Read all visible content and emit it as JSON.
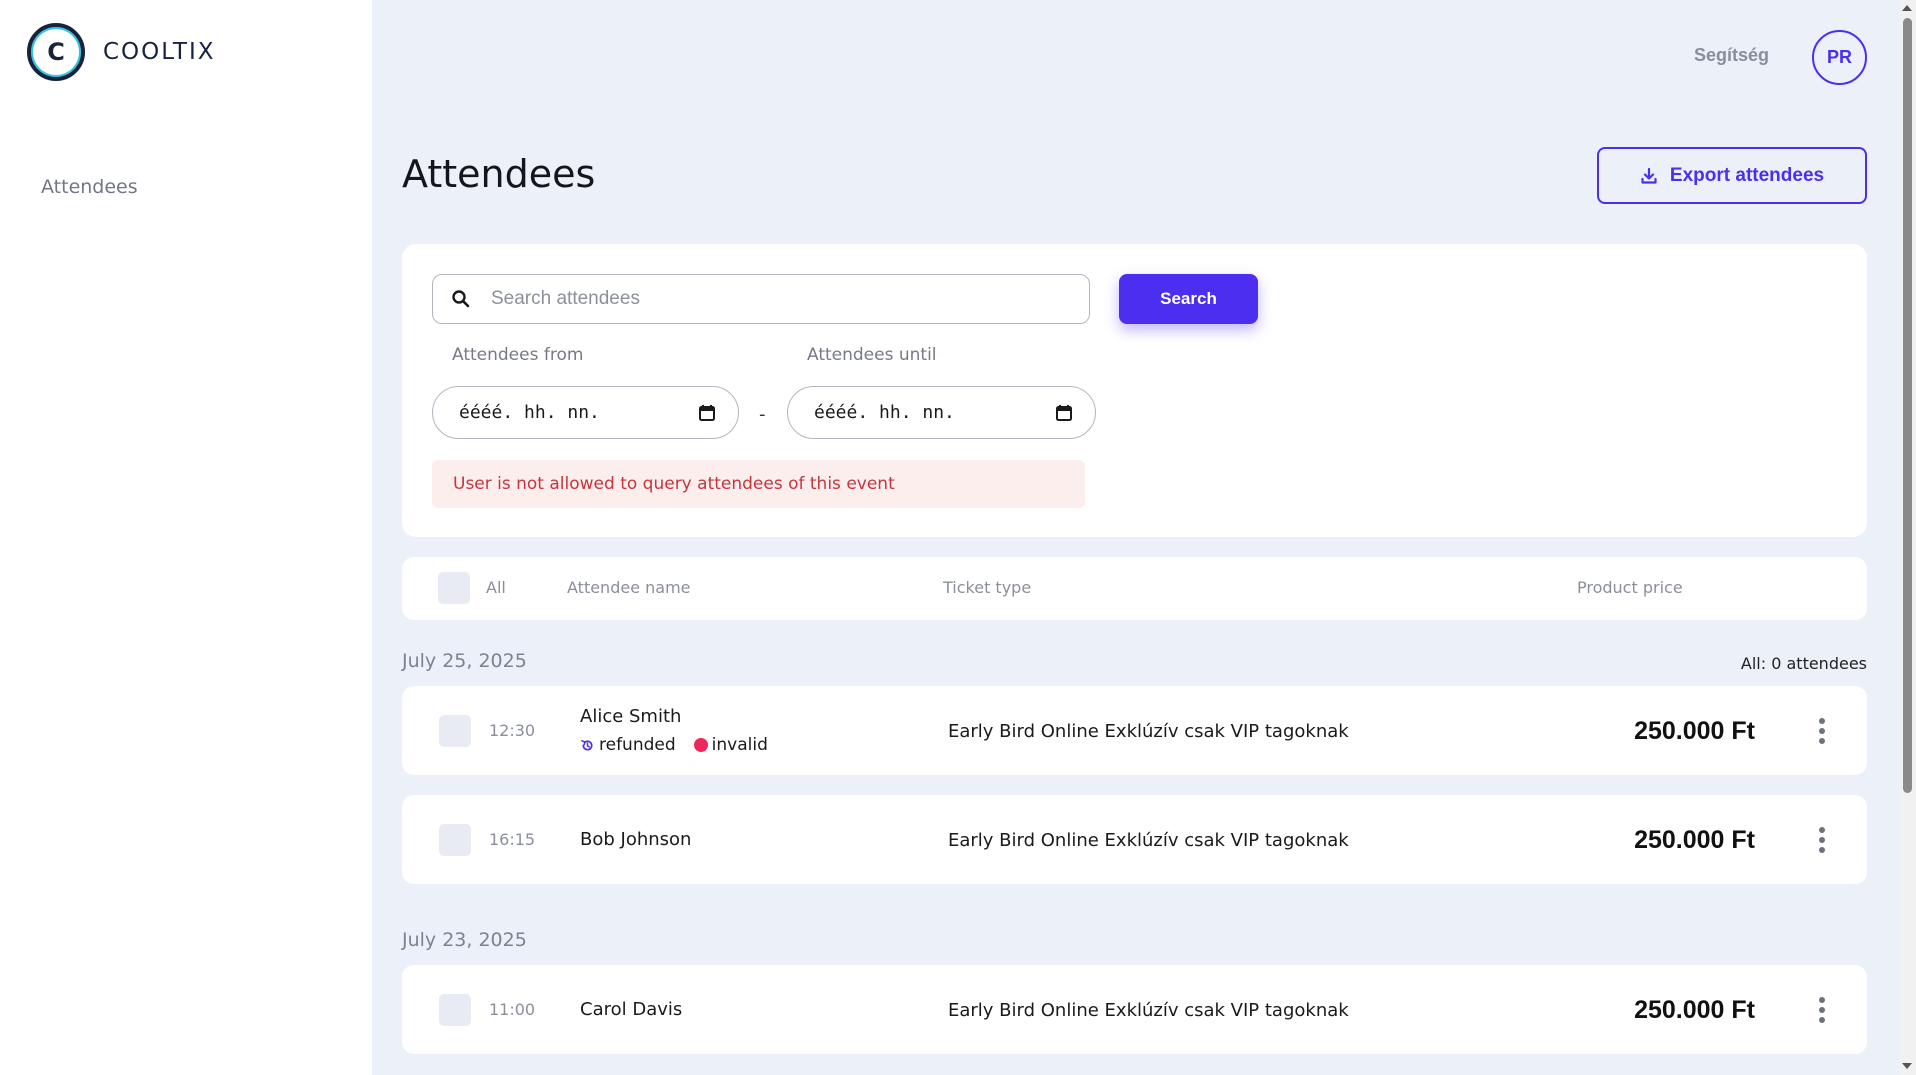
{
  "brand": {
    "name": "COOLTIX",
    "logo_letter": "C"
  },
  "sidebar": {
    "items": [
      {
        "label": "Attendees"
      }
    ]
  },
  "header": {
    "help_label": "Segítség",
    "avatar_initials": "PR"
  },
  "page": {
    "title": "Attendees",
    "export_label": "Export attendees"
  },
  "filters": {
    "search_placeholder": "Search attendees",
    "search_button": "Search",
    "from_label": "Attendees from",
    "until_label": "Attendees until",
    "from_value": "éééé. hh. nn.",
    "until_value": "éééé. hh. nn.",
    "separator": "-",
    "error": "User is not allowed to query attendees of this event"
  },
  "table": {
    "columns": {
      "all": "All",
      "name": "Attendee name",
      "ticket": "Ticket type",
      "price": "Product price"
    },
    "count_label": "All: 0 attendees",
    "groups": [
      {
        "date": "July 25, 2025",
        "rows": [
          {
            "time": "12:30",
            "name": "Alice Smith",
            "ticket": "Early Bird Online Exklúzív csak VIP tagoknak",
            "price": "250.000 Ft",
            "badges": [
              "refunded",
              "invalid"
            ]
          },
          {
            "time": "16:15",
            "name": "Bob Johnson",
            "ticket": "Early Bird Online Exklúzív csak VIP tagoknak",
            "price": "250.000 Ft"
          }
        ]
      },
      {
        "date": "July 23, 2025",
        "rows": [
          {
            "time": "11:00",
            "name": "Carol Davis",
            "ticket": "Early Bird Online Exklúzív csak VIP tagoknak",
            "price": "250.000 Ft"
          }
        ]
      }
    ]
  },
  "colors": {
    "accent": "#4b2ef0",
    "error_text": "#c6353d",
    "error_bg": "#fdeeee",
    "invalid": "#f0275d",
    "background": "#ebf0f9"
  }
}
